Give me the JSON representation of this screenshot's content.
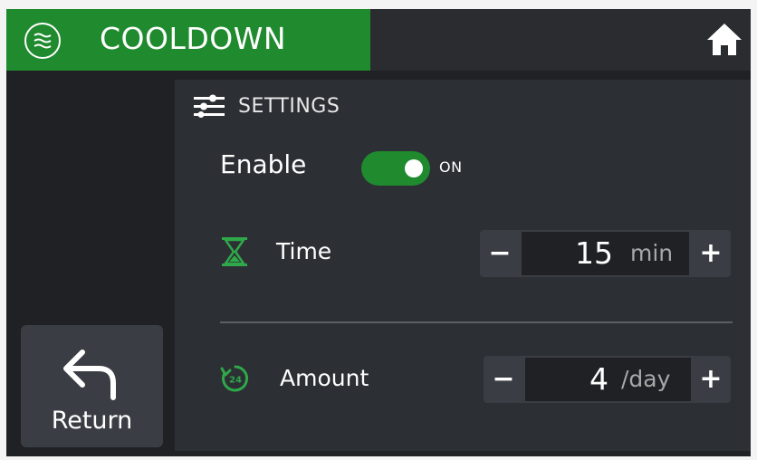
{
  "header": {
    "title": "COOLDOWN",
    "accent_color": "#1f8a2e",
    "mode_icon": "airflow-waves-icon",
    "home_icon": "home-icon"
  },
  "sidebar": {
    "return_label": "Return",
    "return_icon": "return-arrow-icon"
  },
  "settings": {
    "heading": "SETTINGS",
    "heading_icon": "sliders-icon",
    "enable": {
      "label": "Enable",
      "state": "ON",
      "is_on": true
    },
    "time": {
      "label": "Time",
      "icon": "hourglass-icon",
      "decrement": "−",
      "increment": "+",
      "value": "15",
      "unit": "min"
    },
    "amount": {
      "label": "Amount",
      "icon": "24h-cycle-icon",
      "decrement": "−",
      "increment": "+",
      "value": "4",
      "unit": "/day"
    }
  }
}
